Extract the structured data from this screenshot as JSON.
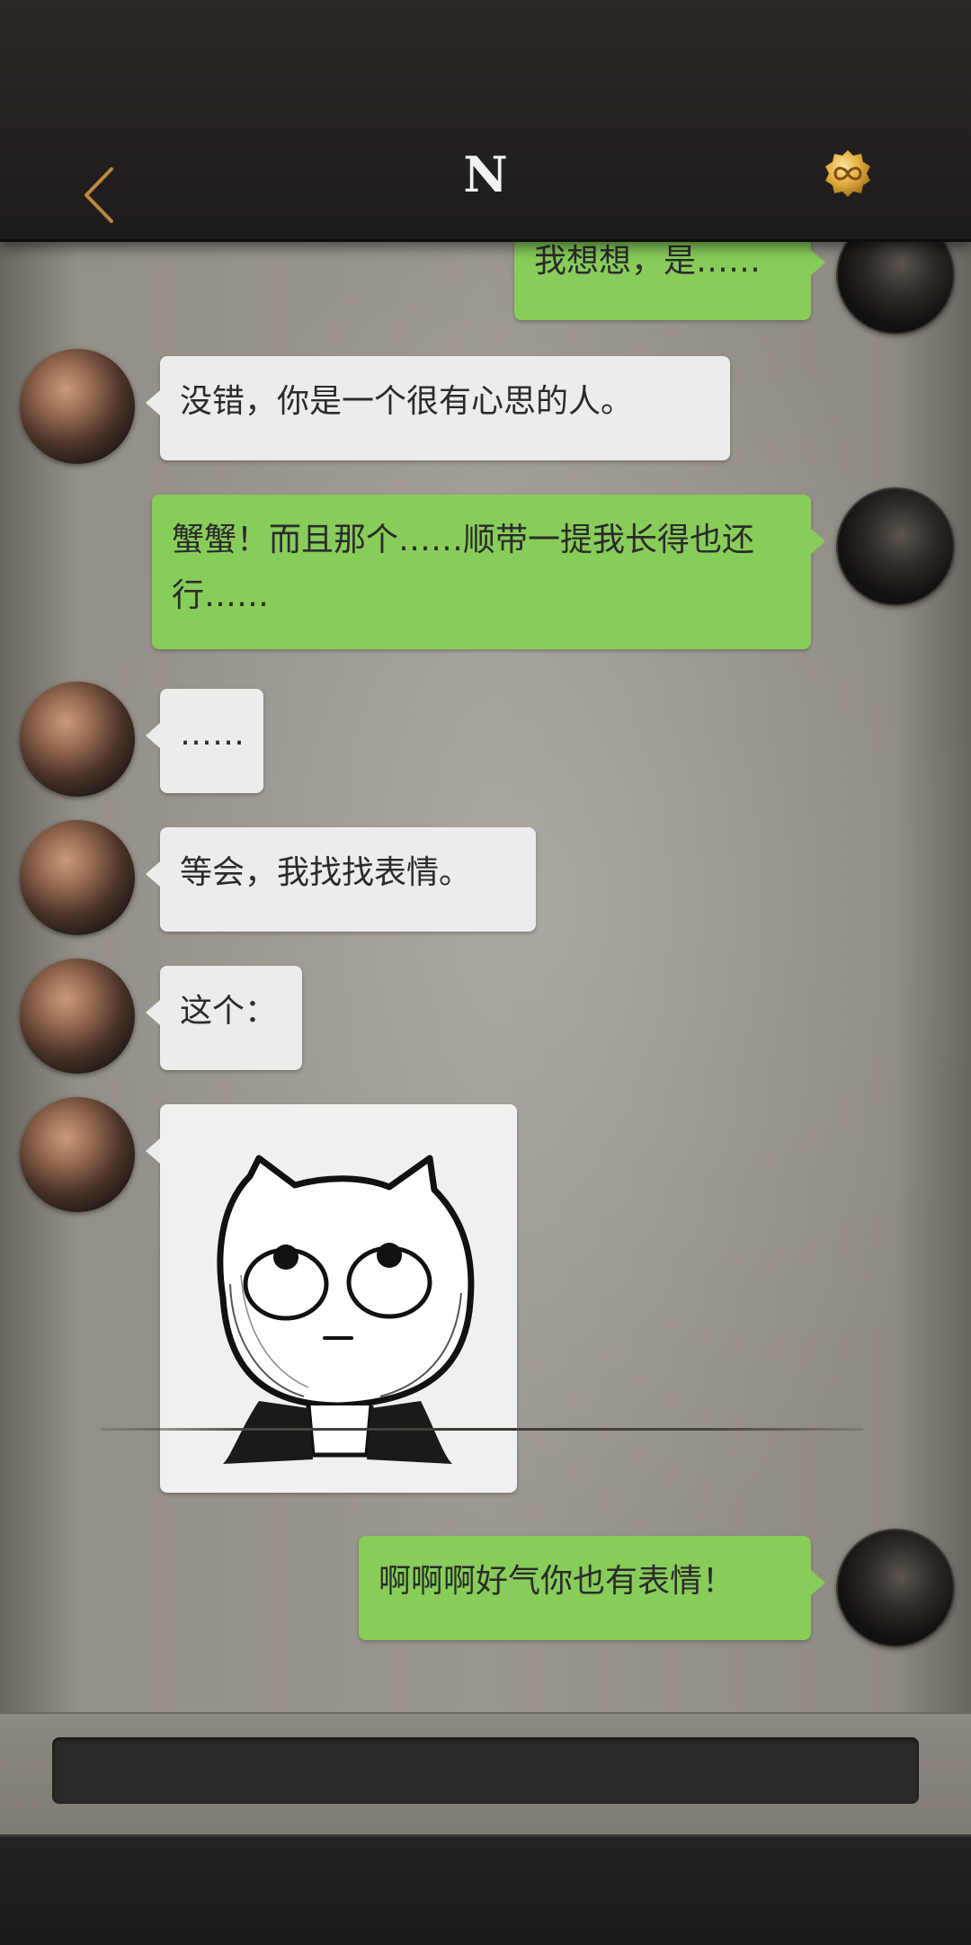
{
  "header": {
    "title": "N",
    "back_icon": "chevron-left-icon",
    "badge_icon": "infinity-badge-icon",
    "accent_color": "#b8893f"
  },
  "messages": [
    {
      "side": "out",
      "text": "我想想，是……"
    },
    {
      "side": "in",
      "text": "没错，你是一个很有心思的人。"
    },
    {
      "side": "out",
      "text": "蟹蟹！而且那个……顺带一提我长得也还行……"
    },
    {
      "side": "in",
      "text": "……"
    },
    {
      "side": "in",
      "text": "等会，我找找表情。"
    },
    {
      "side": "in",
      "text": "这个："
    },
    {
      "side": "in",
      "type": "sticker",
      "sticker_icon": "cartoon-cat-rolling-eyes-sticker"
    },
    {
      "side": "out",
      "text": "啊啊啊好气你也有表情！"
    }
  ],
  "input": {
    "value": ""
  },
  "colors": {
    "outgoing_bubble": "#88cc5a",
    "incoming_bubble": "#ececeb"
  }
}
